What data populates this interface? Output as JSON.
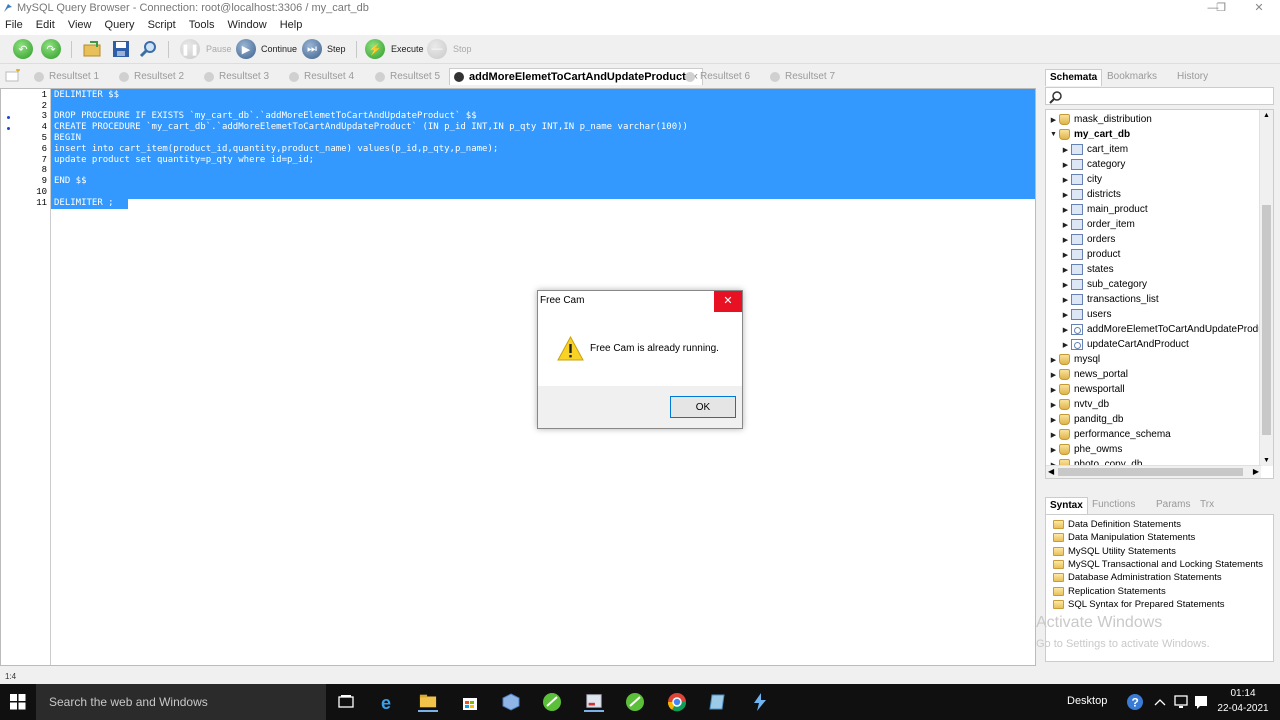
{
  "window": {
    "title": "MySQL Query Browser - Connection: root@localhost:3306 / my_cart_db",
    "minimize": "—",
    "maximize": "❐",
    "close": "✕"
  },
  "menu": [
    "File",
    "Edit",
    "View",
    "Query",
    "Script",
    "Tools",
    "Window",
    "Help"
  ],
  "toolbar": {
    "pause": "Pause",
    "continue": "Continue",
    "step": "Step",
    "execute": "Execute",
    "stop": "Stop"
  },
  "result_tabs": [
    {
      "label": "Resultset 1"
    },
    {
      "label": "Resultset 2"
    },
    {
      "label": "Resultset 3"
    },
    {
      "label": "Resultset 4"
    },
    {
      "label": "Resultset 5"
    },
    {
      "label": "addMoreElemetToCartAndUpdateProduct",
      "close": "×"
    },
    {
      "label": "Resultset 6"
    },
    {
      "label": "Resultset 7"
    }
  ],
  "editor": {
    "line_numbers": [
      "1",
      "2",
      "3",
      "4",
      "5",
      "6",
      "7",
      "8",
      "9",
      "10",
      "11"
    ],
    "lines": [
      "DELIMITER $$",
      "",
      "DROP PROCEDURE IF EXISTS `my_cart_db`.`addMoreElemetToCartAndUpdateProduct` $$",
      "CREATE PROCEDURE `my_cart_db`.`addMoreElemetToCartAndUpdateProduct` (IN p_id INT,IN p_qty INT,IN p_name varchar(100))",
      "BEGIN",
      "insert into cart_item(product_id,quantity,product_name) values(p_id,p_qty,p_name);",
      "update product set quantity=p_qty where id=p_id;",
      "",
      "END $$",
      "",
      "DELIMITER ;"
    ]
  },
  "status": {
    "position": "1:4"
  },
  "schema_panel": {
    "tabs": [
      "Schemata",
      "Bookmarks",
      "History"
    ],
    "search_icon": "magnifier-icon",
    "tree": [
      {
        "label": "mask_distribution",
        "kind": "db",
        "level": 0,
        "arrow": "▶"
      },
      {
        "label": "my_cart_db",
        "kind": "db",
        "level": 0,
        "arrow": "▼",
        "bold": true
      },
      {
        "label": "cart_item",
        "kind": "table",
        "level": 1,
        "arrow": "▶"
      },
      {
        "label": "category",
        "kind": "table",
        "level": 1,
        "arrow": "▶"
      },
      {
        "label": "city",
        "kind": "table",
        "level": 1,
        "arrow": "▶"
      },
      {
        "label": "districts",
        "kind": "table",
        "level": 1,
        "arrow": "▶"
      },
      {
        "label": "main_product",
        "kind": "table",
        "level": 1,
        "arrow": "▶"
      },
      {
        "label": "order_item",
        "kind": "table",
        "level": 1,
        "arrow": "▶"
      },
      {
        "label": "orders",
        "kind": "table",
        "level": 1,
        "arrow": "▶"
      },
      {
        "label": "product",
        "kind": "table",
        "level": 1,
        "arrow": "▶"
      },
      {
        "label": "states",
        "kind": "table",
        "level": 1,
        "arrow": "▶"
      },
      {
        "label": "sub_category",
        "kind": "table",
        "level": 1,
        "arrow": "▶"
      },
      {
        "label": "transactions_list",
        "kind": "table",
        "level": 1,
        "arrow": "▶"
      },
      {
        "label": "users",
        "kind": "table",
        "level": 1,
        "arrow": "▶"
      },
      {
        "label": "addMoreElemetToCartAndUpdateProdu",
        "kind": "proc",
        "level": 1,
        "arrow": "▶"
      },
      {
        "label": "updateCartAndProduct",
        "kind": "proc",
        "level": 1,
        "arrow": "▶"
      },
      {
        "label": "mysql",
        "kind": "db",
        "level": 0,
        "arrow": "▶"
      },
      {
        "label": "news_portal",
        "kind": "db",
        "level": 0,
        "arrow": "▶"
      },
      {
        "label": "newsportall",
        "kind": "db",
        "level": 0,
        "arrow": "▶"
      },
      {
        "label": "nvtv_db",
        "kind": "db",
        "level": 0,
        "arrow": "▶"
      },
      {
        "label": "panditg_db",
        "kind": "db",
        "level": 0,
        "arrow": "▶"
      },
      {
        "label": "performance_schema",
        "kind": "db",
        "level": 0,
        "arrow": "▶"
      },
      {
        "label": "phe_owms",
        "kind": "db",
        "level": 0,
        "arrow": "▶"
      },
      {
        "label": "photo_copy_db",
        "kind": "db",
        "level": 0,
        "arrow": "▶"
      }
    ]
  },
  "syntax_panel": {
    "tabs": [
      "Syntax",
      "Functions",
      "Params",
      "Trx"
    ],
    "items": [
      "Data Definition Statements",
      "Data Manipulation Statements",
      "MySQL Utility Statements",
      "MySQL Transactional and Locking Statements",
      "Database Administration Statements",
      "Replication Statements",
      "SQL Syntax for Prepared Statements"
    ]
  },
  "watermark": {
    "line1": "Activate Windows",
    "line2": "Go to Settings to activate Windows."
  },
  "dialog": {
    "title": "Free Cam",
    "message": "Free Cam is already running.",
    "ok": "OK",
    "close": "✕"
  },
  "taskbar": {
    "search_placeholder": "Search the web and Windows",
    "desktop": "Desktop",
    "time": "01:14",
    "date": "22-04-2021"
  },
  "colors": {
    "selection": "#3399ff",
    "dialog_close": "#e81123",
    "taskbar": "#101010"
  }
}
